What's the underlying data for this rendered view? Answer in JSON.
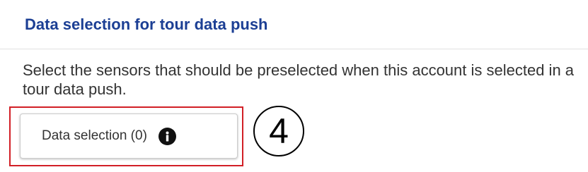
{
  "section": {
    "title": "Data selection for tour data push",
    "description": "Select the sensors that should be preselected when this account is selected in a tour data push."
  },
  "data_selection_button": {
    "label": "Data selection (0)",
    "icon": "info-icon"
  },
  "annotation": {
    "step_number": "4",
    "highlight_color": "#d21f26"
  },
  "colors": {
    "title": "#1c3f94",
    "text": "#333333",
    "divider": "#e1e1e1"
  }
}
